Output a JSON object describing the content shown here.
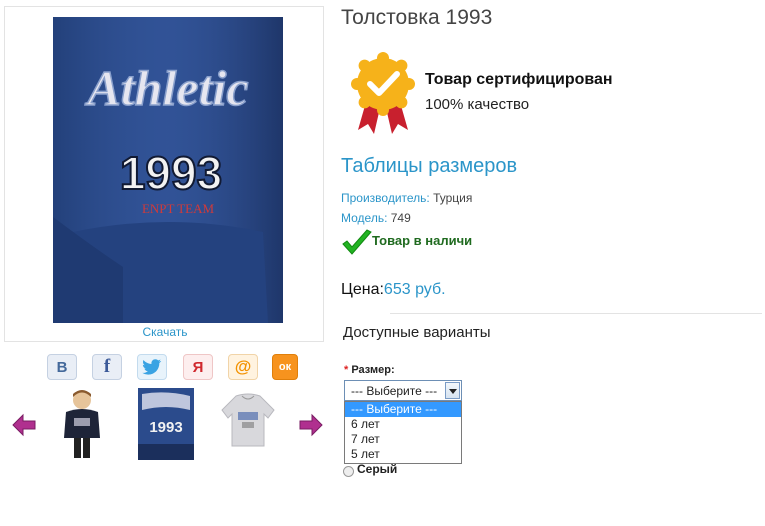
{
  "product": {
    "title": "Толстовка 1993",
    "download_label": "Скачать"
  },
  "share": {
    "vk": "В",
    "fb": "f",
    "lj": "Я",
    "mail": "@",
    "ok": "ок"
  },
  "certificate": {
    "title": "Товар сертифицирован",
    "subtitle": "100% качество"
  },
  "sizes_link": "Таблицы размеров",
  "meta": {
    "manufacturer_label": "Производитель:",
    "manufacturer_value": "Турция",
    "model_label": "Модель:",
    "model_value": "749"
  },
  "stock_text": "Товар в наличи",
  "price": {
    "label": "Цена:",
    "value": "653 руб."
  },
  "variants": {
    "title": "Доступные варианты",
    "size_label": "Размер:",
    "required_mark": "*",
    "selected": "--- Выберите ---",
    "options": [
      "--- Выберите ---",
      "6 лет",
      "7 лет",
      "5 лет"
    ],
    "color_option": "Серый"
  },
  "hoodie_print": {
    "script": "Athletic",
    "year": "1993",
    "team": "ENPT TEAM"
  },
  "colors": {
    "accent": "#2b95c9",
    "hoodie": "#2b4b8c",
    "stock_green": "#1f6a1f",
    "arrow": "#b0308f"
  }
}
